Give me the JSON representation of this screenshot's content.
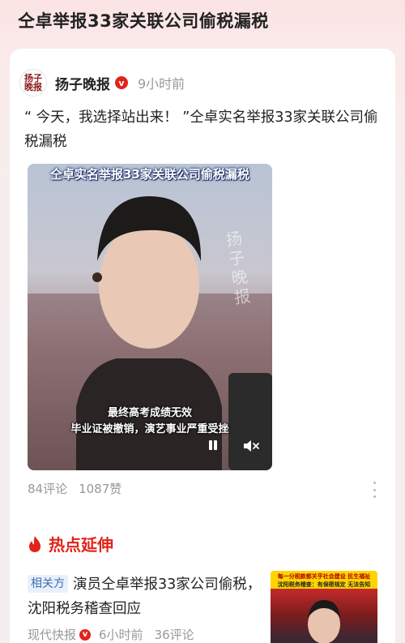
{
  "header": {
    "title": "仝卓举报33家关联公司偷税漏税"
  },
  "post": {
    "author": {
      "name": "扬子晚报",
      "logo_text": "扬子晚报",
      "verified_mark": "v"
    },
    "time": "9小时前",
    "text": "“ 今天，我选择站出来！ ”仝卓实名举报33家关联公司偷税漏税",
    "video": {
      "title_overlay": "仝卓实名举报33家关联公司偷税漏税",
      "watermark": "扬子晚报",
      "subtitle_line1": "最终高考成绩无效",
      "subtitle_line2": "毕业证被撤销，演艺事业严重受挫"
    },
    "stats": {
      "comments": "84评论",
      "likes": "1087赞"
    }
  },
  "hot": {
    "title": "热点延伸",
    "related": {
      "tag": "相关方",
      "text": "演员仝卓举报33家公司偷税，沈阳税务稽查回应",
      "source": "现代快报",
      "verified_mark": "v",
      "time": "6小时前",
      "comments": "36评论",
      "thumb_line1": "每一分税款都关乎社会建设 民生福祉",
      "thumb_line2": "沈阳税务稽查：有保密规定 无法告知"
    }
  },
  "colors": {
    "accent_red": "#e2231a",
    "tag_blue": "#3d6db5",
    "muted": "#999999"
  },
  "icons": [
    "verified-icon",
    "pause-icon",
    "mute-icon",
    "more-icon",
    "flame-icon"
  ]
}
